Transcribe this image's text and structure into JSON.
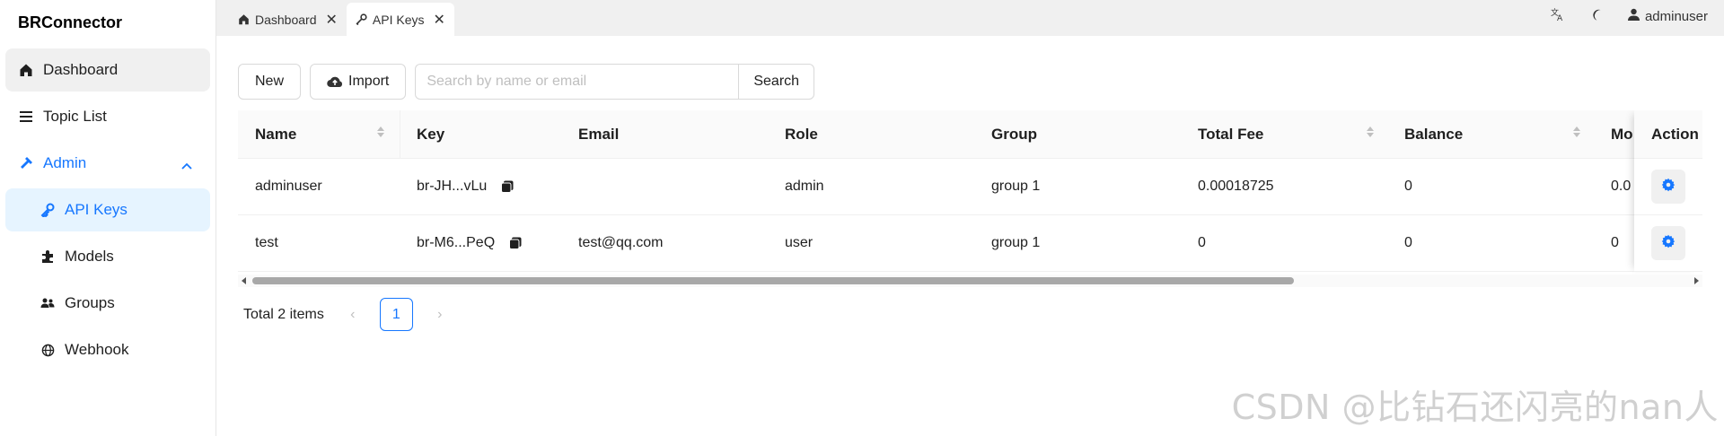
{
  "sidebar": {
    "brand": "BRConnector",
    "items": [
      {
        "label": "Dashboard"
      },
      {
        "label": "Topic List"
      },
      {
        "label": "Admin"
      },
      {
        "label": "API Keys"
      },
      {
        "label": "Models"
      },
      {
        "label": "Groups"
      },
      {
        "label": "Webhook"
      }
    ]
  },
  "tabs": [
    {
      "label": "Dashboard"
    },
    {
      "label": "API Keys"
    }
  ],
  "topbar": {
    "user": "adminuser"
  },
  "toolbar": {
    "new_label": "New",
    "import_label": "Import",
    "search_placeholder": "Search by name or email",
    "search_label": "Search"
  },
  "table": {
    "columns": [
      "Name",
      "Key",
      "Email",
      "Role",
      "Group",
      "Total Fee",
      "Balance",
      "Mo",
      "Action"
    ],
    "rows": [
      {
        "name": "adminuser",
        "key": "br-JH...vLu",
        "email": "",
        "role": "admin",
        "group": "group 1",
        "total_fee": "0.00018725",
        "balance": "0",
        "mo": "0.0"
      },
      {
        "name": "test",
        "key": "br-M6...PeQ",
        "email": "test@qq.com",
        "role": "user",
        "group": "group 1",
        "total_fee": "0",
        "balance": "0",
        "mo": "0"
      }
    ]
  },
  "pagination": {
    "total": "Total 2 items",
    "current_page": "1"
  },
  "watermark": "CSDN @比钻石还闪亮的nan人",
  "colors": {
    "accent": "#1677ff",
    "selected_bg": "#e6f4ff"
  }
}
